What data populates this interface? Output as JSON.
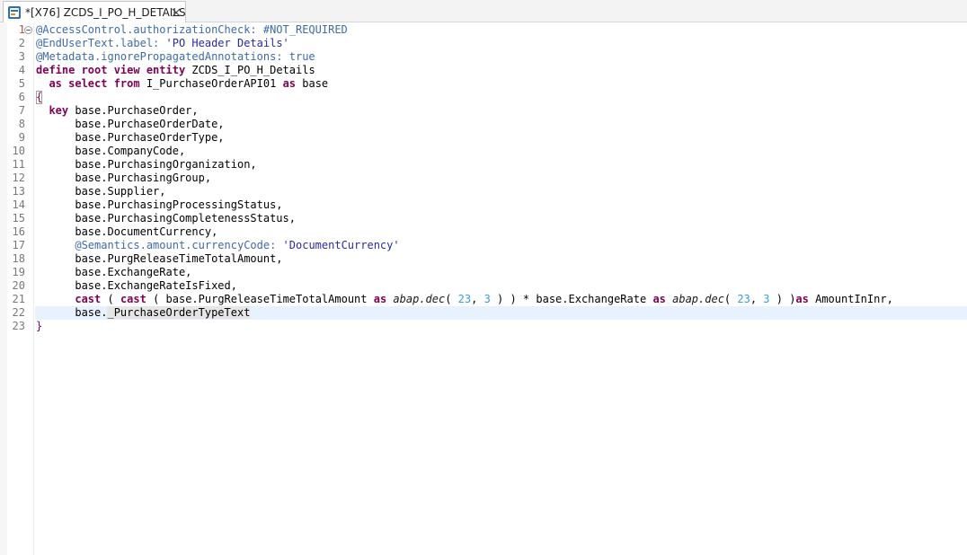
{
  "tab": {
    "title": "*[X76] ZCDS_I_PO_H_DETAILS",
    "icon": "cds-entity-icon",
    "close_icon": "close-icon"
  },
  "editor": {
    "current_line": 22,
    "lines": [
      {
        "n": "1",
        "tokens": [
          {
            "t": "@AccessControl.authorizationCheck: #NOT_REQUIRED",
            "c": "anno"
          }
        ]
      },
      {
        "n": "2",
        "tokens": [
          {
            "t": "@EndUserText.label: ",
            "c": "anno"
          },
          {
            "t": "'PO Header Details'",
            "c": "str"
          }
        ]
      },
      {
        "n": "3",
        "tokens": [
          {
            "t": "@Metadata.ignorePropagatedAnnotations: true",
            "c": "anno"
          }
        ]
      },
      {
        "n": "4",
        "tokens": [
          {
            "t": "define root view entity",
            "c": "kw"
          },
          {
            "t": " ZCDS_I_PO_H_Details",
            "c": ""
          }
        ]
      },
      {
        "n": "5",
        "tokens": [
          {
            "t": "  ",
            "c": ""
          },
          {
            "t": "as select from",
            "c": "kw"
          },
          {
            "t": " I_PurchaseOrderAPI01 ",
            "c": ""
          },
          {
            "t": "as",
            "c": "kw"
          },
          {
            "t": " base",
            "c": ""
          }
        ]
      },
      {
        "n": "6",
        "tokens": [
          {
            "t": "{",
            "c": "brace"
          }
        ]
      },
      {
        "n": "7",
        "tokens": [
          {
            "t": "  ",
            "c": ""
          },
          {
            "t": "key",
            "c": "kw"
          },
          {
            "t": " base.PurchaseOrder,",
            "c": ""
          }
        ]
      },
      {
        "n": "8",
        "tokens": [
          {
            "t": "      base.PurchaseOrderDate,",
            "c": ""
          }
        ]
      },
      {
        "n": "9",
        "tokens": [
          {
            "t": "      base.PurchaseOrderType,",
            "c": ""
          }
        ]
      },
      {
        "n": "10",
        "tokens": [
          {
            "t": "      base.CompanyCode,",
            "c": ""
          }
        ]
      },
      {
        "n": "11",
        "tokens": [
          {
            "t": "      base.PurchasingOrganization,",
            "c": ""
          }
        ]
      },
      {
        "n": "12",
        "tokens": [
          {
            "t": "      base.PurchasingGroup,",
            "c": ""
          }
        ]
      },
      {
        "n": "13",
        "tokens": [
          {
            "t": "      base.Supplier,",
            "c": ""
          }
        ]
      },
      {
        "n": "14",
        "tokens": [
          {
            "t": "      base.PurchasingProcessingStatus,",
            "c": ""
          }
        ]
      },
      {
        "n": "15",
        "tokens": [
          {
            "t": "      base.PurchasingCompletenessStatus,",
            "c": ""
          }
        ]
      },
      {
        "n": "16",
        "tokens": [
          {
            "t": "      base.DocumentCurrency,",
            "c": ""
          }
        ]
      },
      {
        "n": "17",
        "tokens": [
          {
            "t": "      ",
            "c": ""
          },
          {
            "t": "@Semantics.amount.currencyCode: ",
            "c": "anno"
          },
          {
            "t": "'DocumentCurrency'",
            "c": "str"
          }
        ]
      },
      {
        "n": "18",
        "tokens": [
          {
            "t": "      base.PurgReleaseTimeTotalAmount,",
            "c": ""
          }
        ]
      },
      {
        "n": "19",
        "tokens": [
          {
            "t": "      base.ExchangeRate,",
            "c": ""
          }
        ]
      },
      {
        "n": "20",
        "tokens": [
          {
            "t": "      base.ExchangeRateIsFixed,",
            "c": ""
          }
        ]
      },
      {
        "n": "21",
        "tokens": [
          {
            "t": "      ",
            "c": ""
          },
          {
            "t": "cast",
            "c": "kw"
          },
          {
            "t": " ( ",
            "c": ""
          },
          {
            "t": "cast",
            "c": "kw"
          },
          {
            "t": " ( base.PurgReleaseTimeTotalAmount ",
            "c": ""
          },
          {
            "t": "as",
            "c": "kw"
          },
          {
            "t": " ",
            "c": ""
          },
          {
            "t": "abap.dec",
            "c": "type"
          },
          {
            "t": "( ",
            "c": ""
          },
          {
            "t": "23",
            "c": "num"
          },
          {
            "t": ", ",
            "c": ""
          },
          {
            "t": "3",
            "c": "num"
          },
          {
            "t": " ) ) * base.ExchangeRate ",
            "c": ""
          },
          {
            "t": "as",
            "c": "kw"
          },
          {
            "t": " ",
            "c": ""
          },
          {
            "t": "abap.dec",
            "c": "type"
          },
          {
            "t": "( ",
            "c": ""
          },
          {
            "t": "23",
            "c": "num"
          },
          {
            "t": ", ",
            "c": ""
          },
          {
            "t": "3",
            "c": "num"
          },
          {
            "t": " ) )",
            "c": ""
          },
          {
            "t": "as",
            "c": "kw"
          },
          {
            "t": " AmountInInr,",
            "c": ""
          }
        ]
      },
      {
        "n": "22",
        "tokens": [
          {
            "t": "      base.",
            "c": ""
          },
          {
            "t": "_PurchaseOrderTypeText",
            "c": "sel"
          }
        ]
      },
      {
        "n": "23",
        "tokens": [
          {
            "t": "}",
            "c": "brace"
          }
        ]
      }
    ]
  }
}
